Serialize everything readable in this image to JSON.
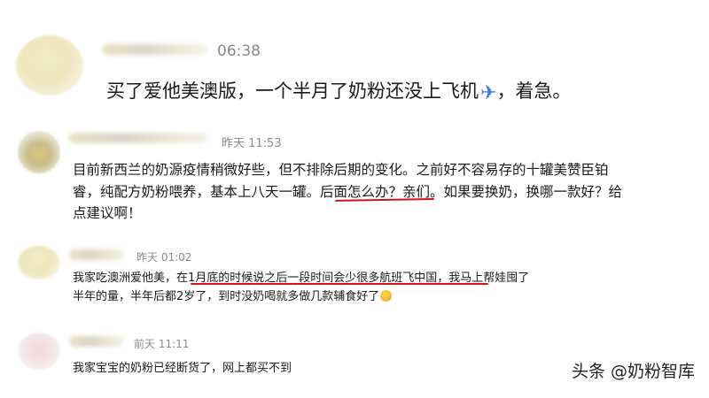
{
  "comments": [
    {
      "time": "06:38",
      "lines": [
        "买了爱他美澳版，一个半月了奶粉还没上飞机",
        "，着急。"
      ],
      "icon": "airplane-icon"
    },
    {
      "time": "昨天 11:53",
      "lines": [
        "目前新西兰的奶源疫情稍微好些，但不排除后期的变化。之前好不容易存的十罐美赞臣铂",
        "睿，纯配方奶粉喂养，基本上八天一罐。",
        "后面怎么办？亲们",
        "。如果要换奶，换哪一款好？给",
        "点建议啊！"
      ]
    },
    {
      "time": "昨天 01:02",
      "lines": [
        "我家吃澳洲爱他美，",
        "在1月底的时候说之后一段时间会少很多航班飞中国",
        "，我马上帮娃囤了",
        "半年的量，半年后都2岁了，到时没奶喝就多做几款辅食好了"
      ],
      "icon": "grin-emoji-icon"
    },
    {
      "time": "前天 11:11",
      "lines": [
        "我家宝宝的奶粉已经断货了，网上都买不到"
      ]
    }
  ],
  "watermark": "头条 @奶粉智库",
  "colors": {
    "underline": "#d4101b",
    "time": "#8a8a8a"
  }
}
